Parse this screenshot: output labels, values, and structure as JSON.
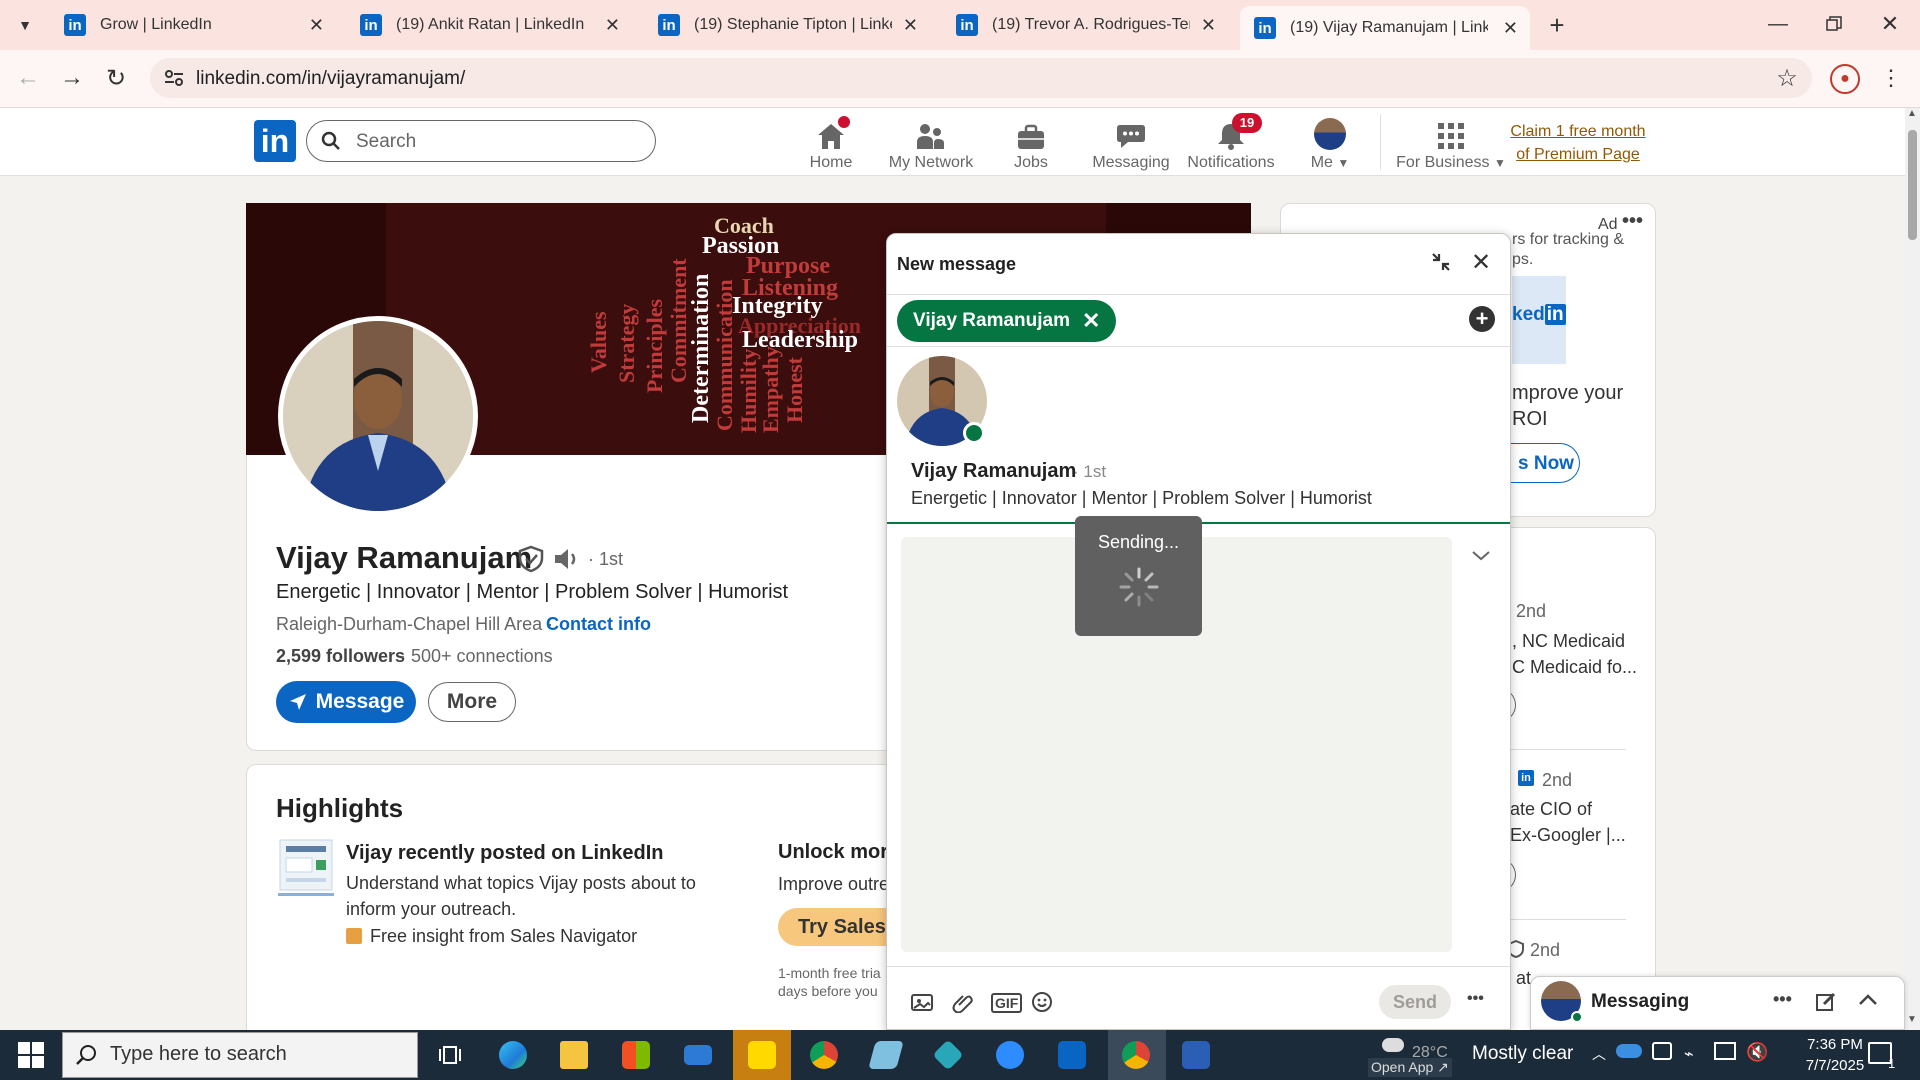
{
  "browser": {
    "tabs": [
      {
        "title": "Grow | LinkedIn"
      },
      {
        "title": "(19) Ankit Ratan | LinkedIn"
      },
      {
        "title": "(19) Stephanie Tipton | LinkedIn"
      },
      {
        "title": "(19) Trevor A. Rodrigues-Templar"
      },
      {
        "title": "(19) Vijay Ramanujam | LinkedIn"
      }
    ],
    "url": "linkedin.com/in/vijayramanujam/"
  },
  "linkedin_nav": {
    "logo": "in",
    "search_placeholder": "Search",
    "items": [
      {
        "label": "Home",
        "badge": "",
        "icon": "home-icon"
      },
      {
        "label": "My Network",
        "badge": "",
        "icon": "network-icon"
      },
      {
        "label": "Jobs",
        "badge": "",
        "icon": "briefcase-icon"
      },
      {
        "label": "Messaging",
        "badge": "",
        "icon": "chat-icon"
      },
      {
        "label": "Notifications",
        "badge": "19",
        "icon": "bell-icon"
      },
      {
        "label": "Me",
        "badge": "",
        "icon": "avatar"
      },
      {
        "label": "For Business",
        "badge": "",
        "icon": "grid-icon"
      }
    ],
    "premium_line1": "Claim 1 free month",
    "premium_line2": "of Premium Page"
  },
  "profile": {
    "banner_words": [
      "Coach",
      "Passion",
      "Purpose",
      "Listening",
      "Integrity",
      "Appreciation",
      "Leadership",
      "Values",
      "Strategy",
      "Principles",
      "Commitment",
      "Determination",
      "Communication",
      "Humility",
      "Empathy",
      "Honest"
    ],
    "name": "Vijay Ramanujam",
    "degree": "· 1st",
    "headline": "Energetic | Innovator | Mentor | Problem Solver | Humorist",
    "location": "Raleigh-Durham-Chapel Hill Area ·",
    "contact_info": "Contact info",
    "followers": "2,599 followers",
    "connections": "· 500+ connections",
    "message_button": "Message",
    "more_button": "More"
  },
  "highlights": {
    "title": "Highlights",
    "post_title": "Vijay recently posted on LinkedIn",
    "post_desc_line1": "Understand what topics Vijay posts about to",
    "post_desc_line2": "inform your outreach.",
    "insight": "Free insight from Sales Navigator",
    "unlock_title": "Unlock more",
    "unlock_desc": "Improve outre",
    "try_button": "Try Sales N",
    "trial_line1": "1-month free tria",
    "trial_line2": "days before you"
  },
  "right_rail": {
    "ad_label": "Ad",
    "ad_text1": "rs for tracking &",
    "ad_text2": "ps.",
    "ad_text3": "mprove your",
    "ad_text4": "ROI",
    "ad_button": "s Now",
    "people": [
      {
        "degree": "2nd",
        "line1": ", NC Medicaid",
        "line2": "C Medicaid fo..."
      },
      {
        "degree": "2nd",
        "line1": "ate CIO of",
        "line2": "Ex-Googler |..."
      },
      {
        "degree": "2nd",
        "line1": "at",
        "line2": ""
      }
    ],
    "messaging_label": "Messaging"
  },
  "message_dialog": {
    "title": "New message",
    "recipient_chip": "Vijay Ramanujam",
    "recipient_name": "Vijay Ramanujam",
    "recipient_degree": "· 1st",
    "recipient_headline": "Energetic | Innovator | Mentor | Problem Solver | Humorist",
    "status": "Sending...",
    "send_button": "Send"
  },
  "taskbar": {
    "search_placeholder": "Type here to search",
    "weather_temp": "28°C",
    "weather_text": "Mostly clear",
    "open_app": "Open App ↗",
    "time": "7:36 PM",
    "date": "7/7/2025",
    "notification_count": "1"
  },
  "colors": {
    "linkedin_blue": "#0a66c2",
    "tab_bar": "#fbe4e0",
    "chip_green": "#057642",
    "taskbar": "#1c2b3a"
  }
}
